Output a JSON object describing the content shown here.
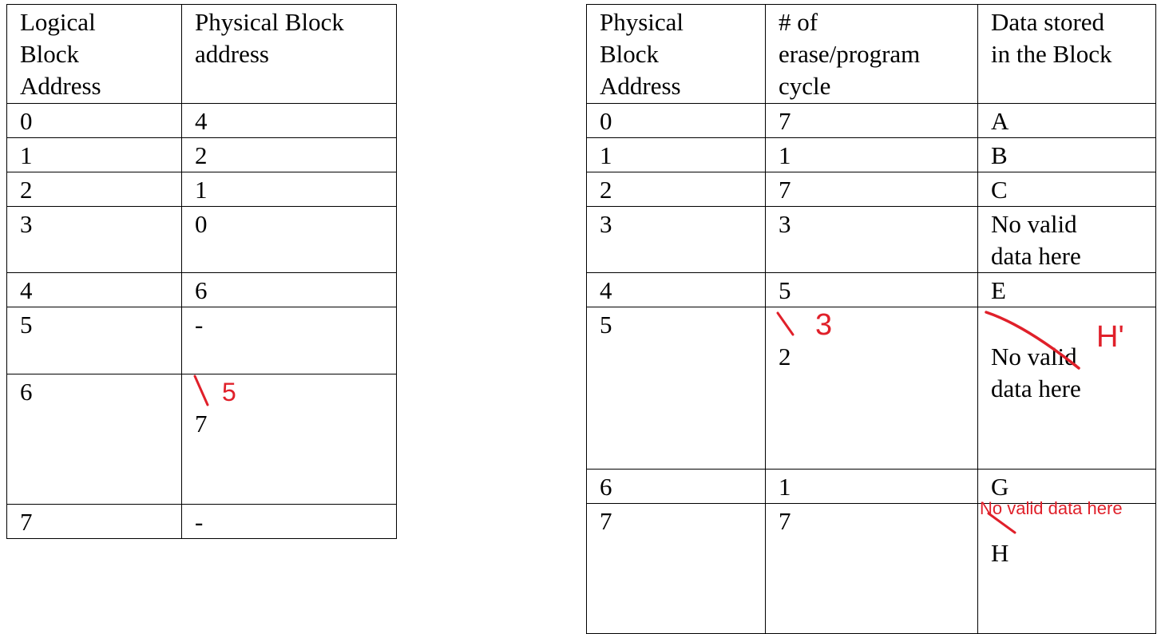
{
  "logical_table": {
    "headers": [
      "Logical\nBlock\nAddress",
      "Physical Block\naddress"
    ],
    "rows": [
      [
        " 0",
        "4"
      ],
      [
        " 1",
        "2"
      ],
      [
        "2",
        "1"
      ],
      [
        "3",
        "0"
      ],
      [
        "4",
        "6"
      ],
      [
        "5",
        "-"
      ],
      [
        "6",
        "7"
      ],
      [
        "7",
        "-"
      ]
    ]
  },
  "physical_table": {
    "headers": [
      "Physical\nBlock\nAddress",
      "# of\nerase/program\ncycle",
      "Data stored\nin the Block"
    ],
    "rows": [
      [
        " 0",
        "7",
        "A"
      ],
      [
        "1",
        "1",
        "B"
      ],
      [
        "2",
        "7",
        "C"
      ],
      [
        "3",
        "3",
        "No valid\ndata here"
      ],
      [
        "4",
        "5",
        "E"
      ],
      [
        "5",
        "2",
        "No valid\ndata here"
      ],
      [
        "6",
        "1",
        "G"
      ],
      [
        "7",
        "7",
        "H"
      ]
    ]
  },
  "annotations": {
    "logical_row6_new": "5",
    "physical_row5_cycle_new": "3",
    "physical_row5_data_new": "H'",
    "physical_row7_data_new": "No valid data here"
  },
  "colors": {
    "annotation_red": "#e0202a"
  }
}
